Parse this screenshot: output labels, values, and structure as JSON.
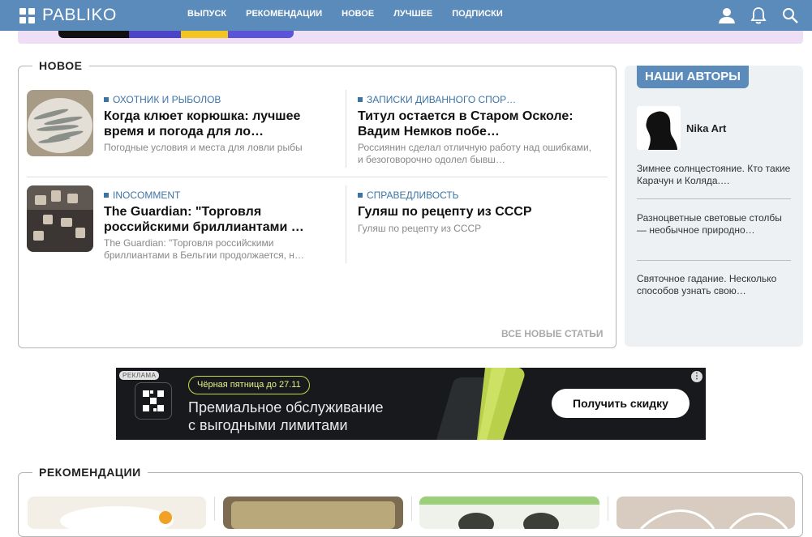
{
  "header": {
    "logo_text": "PABLIKO",
    "nav": [
      "ВЫПУСК",
      "РЕКОМЕНДАЦИИ",
      "НОВОЕ",
      "ЛУЧШЕЕ",
      "ПОДПИСКИ"
    ],
    "icons": [
      "user-icon",
      "bell-icon",
      "search-icon"
    ]
  },
  "new_section": {
    "title": "НОВОЕ",
    "articles": [
      {
        "category": "ОХОТНИК И РЫБОЛОВ",
        "title": "Когда клюет корюшка: лучшее время и погода для ло…",
        "description": "Погодные условия и места для ловли рыбы"
      },
      {
        "category": "ЗАПИСКИ ДИВАННОГО СПОР…",
        "title": "Титул остается в Старом Осколе: Вадим Немков побе…",
        "description": "Россиянин сделал отличную работу над ошибками, и безоговорочно одолел бывш…"
      },
      {
        "category": "INOCOMMENT",
        "title": "The Guardian: \"Торговля российскими бриллиантами …",
        "description": "The Guardian: \"Торговля российскими бриллиантами в Бельгии продолжается, н…"
      },
      {
        "category": "СПРАВЕДЛИВОСТЬ",
        "title": "Гуляш по рецепту из СССР",
        "description": "Гуляш по рецепту из СССР"
      }
    ],
    "all_link": "ВСЕ НОВЫЕ СТАТЬИ"
  },
  "authors": {
    "title": "НАШИ АВТОРЫ",
    "name": "Nika Art",
    "posts": [
      "Зимнее солнцестояние. Кто такие Карачун и Коляда.…",
      "Разноцветные световые столбы — необычное природно…",
      "Святочное гадание. Несколько способов узнать свою…"
    ]
  },
  "ad": {
    "label": "РЕКЛАМА",
    "pill": "Чёрная пятница до 27.11",
    "line1": "Премиальное обслуживание",
    "line2": "с выгодными лимитами",
    "button": "Получить скидку"
  },
  "recommendations": {
    "title": "РЕКОМЕНДАЦИИ"
  },
  "colors": {
    "header": "#5b8bba",
    "category": "#3d74a6",
    "strip": "#efdff6",
    "ad_bg": "#17191c"
  }
}
